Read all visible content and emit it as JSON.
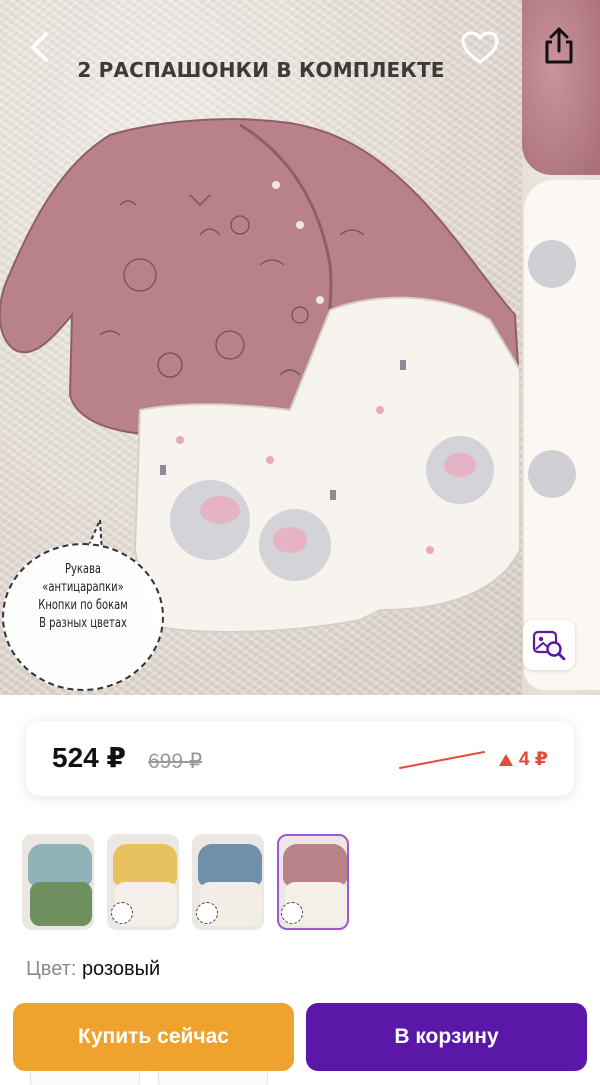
{
  "product": {
    "image_title": "2 РАСПАШОНКИ В КОМПЛЕКТЕ",
    "callout_lines": [
      "Рукава",
      "«антицарапки»",
      "Кнопки по бокам",
      "В разных цветах"
    ]
  },
  "icons": {
    "back": "chevron-left-icon",
    "favorite": "heart-icon",
    "share": "share-icon",
    "photo_search": "image-search-icon"
  },
  "price": {
    "current": "524 ₽",
    "old": "699 ₽",
    "delta": "4 ₽",
    "delta_direction": "up",
    "delta_color": "#e24a3b"
  },
  "variants": [
    {
      "name": "green",
      "top": "#8fb3b8",
      "bottom": "#6f8f5f",
      "active": false
    },
    {
      "name": "yellow",
      "top": "#e8c25e",
      "bottom": "#f4efe8",
      "active": false
    },
    {
      "name": "blue",
      "top": "#6f90a8",
      "bottom": "#f2ede6",
      "active": false
    },
    {
      "name": "pink",
      "top": "#b98289",
      "bottom": "#f4efe8",
      "active": true
    }
  ],
  "color": {
    "label": "Цвет:",
    "value": "розовый"
  },
  "actions": {
    "buy_now": "Купить сейчас",
    "add_to_cart": "В корзину"
  },
  "theme": {
    "buy_color": "#f0a22e",
    "cart_color": "#5b17a8",
    "active_border": "#9b59d9"
  }
}
